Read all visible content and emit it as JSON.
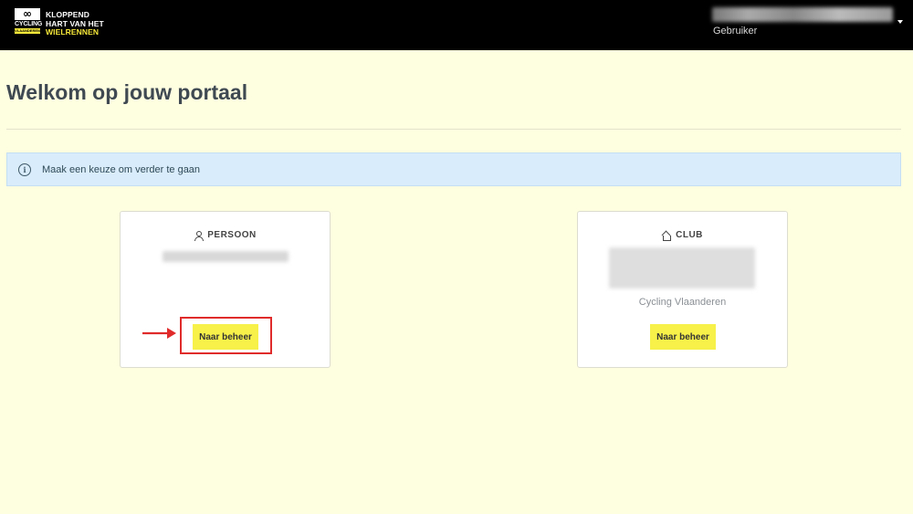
{
  "header": {
    "logo": {
      "mark": "∞",
      "mark_sub": "CYCLING",
      "mark_tag": "VLAANDEREN",
      "line1": "KLOPPEND",
      "line2": "HART VAN HET",
      "line3": "WIELRENNEN"
    },
    "user": {
      "role": "Gebruiker"
    }
  },
  "page": {
    "title": "Welkom op jouw portaal"
  },
  "alert": {
    "icon": "info-icon",
    "text": "Maak een keuze om verder te gaan"
  },
  "cards": {
    "person": {
      "icon": "person-icon",
      "heading": "PERSOON",
      "button_label": "Naar beheer"
    },
    "club": {
      "icon": "home-icon",
      "heading": "CLUB",
      "organization": "Cycling Vlaanderen",
      "button_label": "Naar beheer"
    }
  },
  "colors": {
    "background": "#fefee0",
    "topbar": "#000000",
    "brand_yellow": "#f7e93a",
    "button": "#f7f14a",
    "alert_bg": "#d9ecfb",
    "annotation_red": "#e02b2b"
  }
}
